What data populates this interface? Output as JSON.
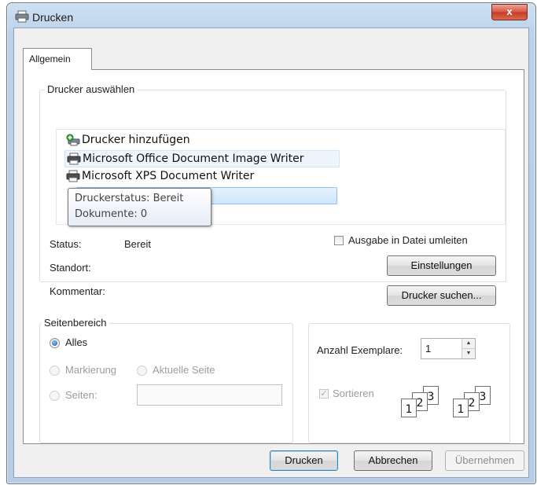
{
  "window": {
    "title": "Drucken",
    "close_glyph": "x"
  },
  "tabs": [
    {
      "label": "Allgemein"
    }
  ],
  "printer_group": {
    "legend": "Drucker auswählen",
    "printers": [
      {
        "name": "Drucker hinzufügen",
        "icon": "add-printer-icon"
      },
      {
        "name": "Microsoft Office Document Image Writer",
        "icon": "printer-icon"
      },
      {
        "name": "Microsoft XPS Document Writer",
        "icon": "printer-icon"
      }
    ],
    "tooltip": {
      "line1": "Druckerstatus: Bereit",
      "line2": "Dokumente: 0"
    },
    "status_label": "Status:",
    "status_value": "Bereit",
    "location_label": "Standort:",
    "comment_label": "Kommentar:",
    "print_to_file_label": "Ausgabe in Datei umleiten",
    "preferences_button": "Einstellungen",
    "find_printer_button": "Drucker suchen..."
  },
  "page_range": {
    "legend": "Seitenbereich",
    "all_label": "Alles",
    "selection_label": "Markierung",
    "current_page_label": "Aktuelle Seite",
    "pages_label": "Seiten:"
  },
  "copies": {
    "label": "Anzahl Exemplare:",
    "value": "1",
    "collate_label": "Sortieren",
    "page_numbers": [
      "1",
      "2",
      "3"
    ]
  },
  "buttons": {
    "print": "Drucken",
    "cancel": "Abbrechen",
    "apply": "Übernehmen"
  }
}
